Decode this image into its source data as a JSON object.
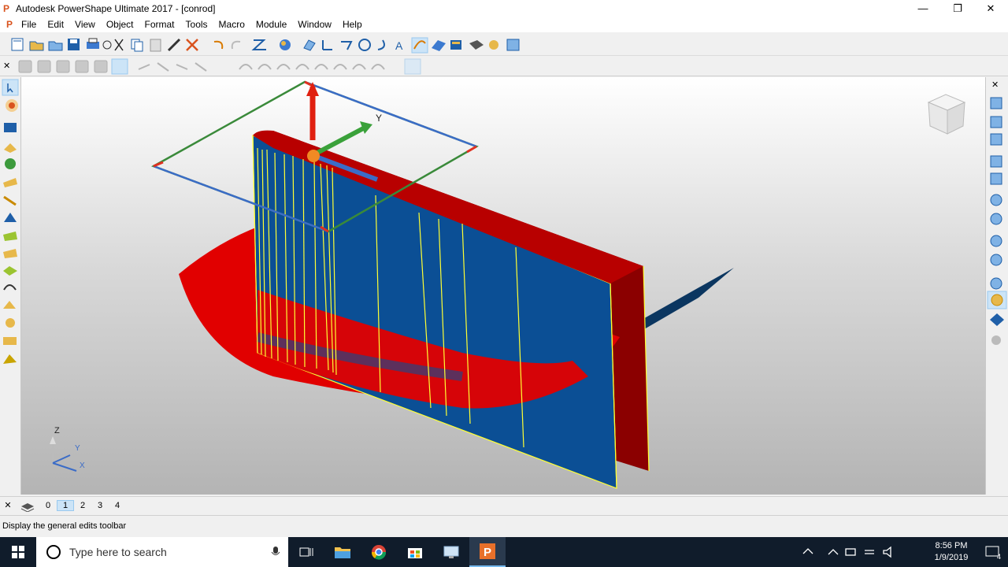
{
  "window": {
    "title": "Autodesk PowerShape Ultimate 2017 - [conrod]",
    "minimize_glyph": "—",
    "restore_glyph": "❐",
    "close_glyph": "✕"
  },
  "menu": {
    "items": [
      "File",
      "Edit",
      "View",
      "Object",
      "Format",
      "Tools",
      "Macro",
      "Module",
      "Window",
      "Help"
    ]
  },
  "mdi": {
    "minimize_glyph": "–",
    "restore_glyph": "▫",
    "close_glyph": "✕"
  },
  "toolbar_close": "✕",
  "axis_labels": {
    "z": "Z",
    "y": "Y",
    "x": "X"
  },
  "workplane_label": "Y",
  "layers": {
    "close": "✕",
    "items": [
      "0",
      "1",
      "2",
      "3",
      "4"
    ],
    "active": "1"
  },
  "status": {
    "message": "Display the general edits toolbar"
  },
  "taskbar": {
    "search_placeholder": "Type here to search",
    "time": "8:56 PM",
    "date": "1/9/2019",
    "notification_count": "4"
  },
  "colors": {
    "accent": "#d9531e",
    "surface_red": "#e10000",
    "surface_blue": "#0a4a8e",
    "edge_yellow": "#ffff33",
    "taskbar": "#101c2b"
  }
}
